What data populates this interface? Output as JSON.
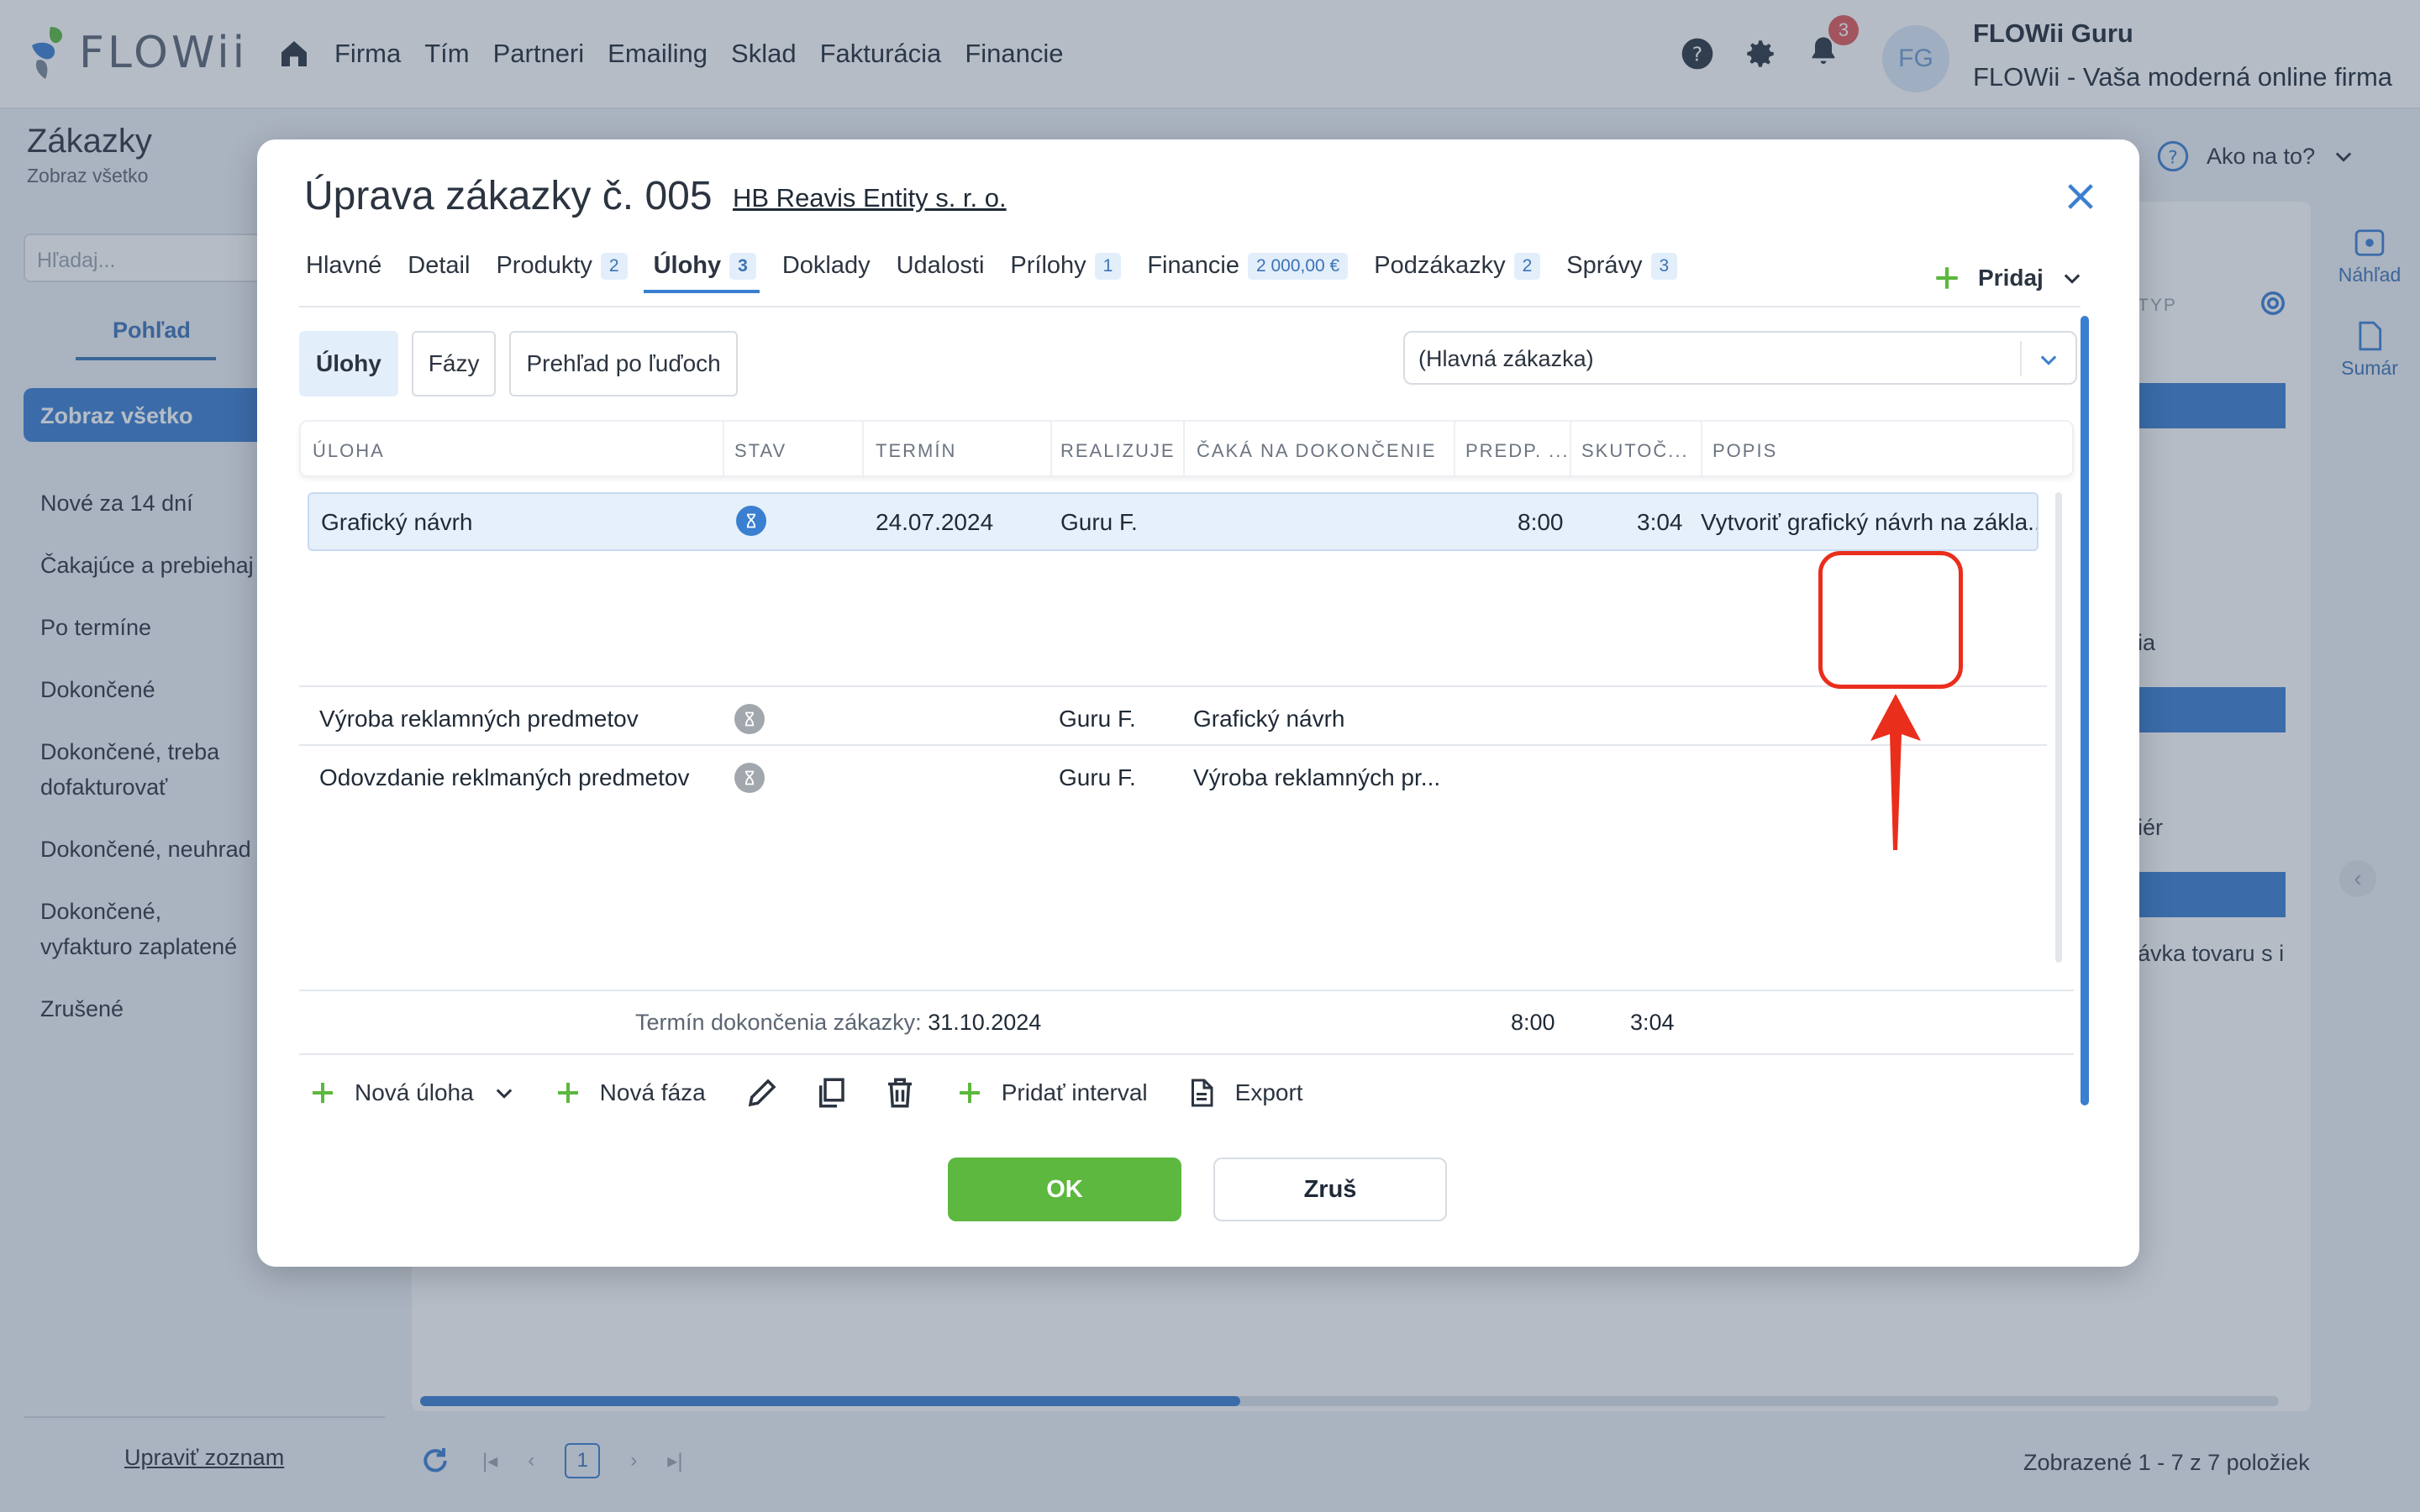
{
  "brand": {
    "name": "FLOWii",
    "accent": "#3a7fd0",
    "green": "#5cb83e",
    "annotation": "#ea2e1c"
  },
  "nav": [
    "Firma",
    "Tím",
    "Partneri",
    "Emailing",
    "Sklad",
    "Fakturácia",
    "Financie"
  ],
  "header": {
    "notifications": "3",
    "avatar": "FG",
    "user_name": "FLOWii Guru",
    "company": "FLOWii - Vaša moderná online firma",
    "help": "Ako na to?"
  },
  "page": {
    "title": "Zákazky",
    "subtitle": "Zobraz všetko",
    "search_placeholder": "Hľadaj...",
    "view_tab": "Pohľad"
  },
  "sidebar": {
    "active": "Zobraz všetko",
    "items": [
      "Nové za 14 dní",
      "Čakajúce a prebiehaj",
      "Po termíne",
      "Dokončené",
      "Dokončené, treba dofakturovať",
      "Dokončené, neuhrad",
      "Dokončené, vyfakturo zaplatené",
      "Zrušené"
    ],
    "edit": "Upraviť zoznam"
  },
  "background_grid": {
    "col_hint": "TYP",
    "texts": [
      "ia",
      "iér",
      "ávka tovaru s i"
    ],
    "pager_page": "1",
    "pager_info": "Zobrazené 1 - 7 z 7 položiek",
    "rail": [
      "Náhľad",
      "Sumár"
    ]
  },
  "modal": {
    "title": "Úprava zákazky č. 005",
    "customer": "HB Reavis Entity s. r. o.",
    "tabs": [
      {
        "label": "Hlavné",
        "count": ""
      },
      {
        "label": "Detail",
        "count": ""
      },
      {
        "label": "Produkty",
        "count": "2"
      },
      {
        "label": "Úlohy",
        "count": "3"
      },
      {
        "label": "Doklady",
        "count": ""
      },
      {
        "label": "Udalosti",
        "count": ""
      },
      {
        "label": "Prílohy",
        "count": "1"
      },
      {
        "label": "Financie",
        "count": "2 000,00 €"
      },
      {
        "label": "Podzákazky",
        "count": "2"
      },
      {
        "label": "Správy",
        "count": "3"
      }
    ],
    "active_tab": "Úlohy",
    "add": "Pridaj",
    "subtabs": [
      "Úlohy",
      "Fázy",
      "Prehľad po ľuďoch"
    ],
    "select_value": "(Hlavná zákazka)",
    "columns": [
      "ÚLOHA",
      "STAV",
      "TERMÍN",
      "REALIZUJE",
      "ČAKÁ NA DOKONČENIE",
      "PREDP. ...",
      "SKUTOČ...",
      "POPIS"
    ],
    "rows": [
      {
        "task": "Grafický návrh",
        "status": "in-progress",
        "due": "24.07.2024",
        "assignee": "Guru F.",
        "waits_for": "",
        "planned": "8:00",
        "actual": "3:04",
        "desc": "Vytvoriť grafický návrh na zákla..."
      },
      {
        "task": "Výroba reklamných predmetov",
        "status": "waiting",
        "due": "",
        "assignee": "Guru F.",
        "waits_for": "Grafický návrh",
        "planned": "",
        "actual": "",
        "desc": ""
      },
      {
        "task": "Odovzdanie reklmaných predmetov",
        "status": "waiting",
        "due": "",
        "assignee": "Guru F.",
        "waits_for": "Výroba reklamných pr...",
        "planned": "",
        "actual": "",
        "desc": ""
      }
    ],
    "footer_label": "Termín dokončenia zákazky:",
    "footer_date": "31.10.2024",
    "total_planned": "8:00",
    "total_actual": "3:04",
    "actions": [
      "Nová úloha",
      "Nová fáza",
      "Pridať interval",
      "Export"
    ],
    "ok": "OK",
    "cancel": "Zruš"
  }
}
